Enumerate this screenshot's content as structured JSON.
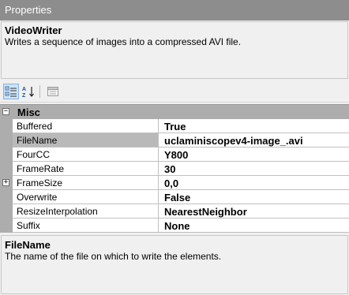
{
  "panel": {
    "title": "Properties"
  },
  "node": {
    "name": "VideoWriter",
    "description": "Writes a sequence of images into a compressed AVI file."
  },
  "toolbar": {
    "buttons": [
      {
        "icon": "categorized-icon",
        "active": true
      },
      {
        "icon": "alphabetical-sort-icon",
        "active": false
      },
      {
        "icon": "property-pages-icon",
        "active": false
      }
    ]
  },
  "grid": {
    "category": "Misc",
    "properties": [
      {
        "name": "Buffered",
        "value": "True",
        "expandable": false,
        "selected": false
      },
      {
        "name": "FileName",
        "value": "uclaminiscopev4-image_.avi",
        "expandable": false,
        "selected": true
      },
      {
        "name": "FourCC",
        "value": "Y800",
        "expandable": false,
        "selected": false
      },
      {
        "name": "FrameRate",
        "value": "30",
        "expandable": false,
        "selected": false
      },
      {
        "name": "FrameSize",
        "value": "0,0",
        "expandable": true,
        "selected": false
      },
      {
        "name": "Overwrite",
        "value": "False",
        "expandable": false,
        "selected": false
      },
      {
        "name": "ResizeInterpolation",
        "value": "NearestNeighbor",
        "expandable": false,
        "selected": false
      },
      {
        "name": "Suffix",
        "value": "None",
        "expandable": false,
        "selected": false
      }
    ]
  },
  "help": {
    "title": "FileName",
    "text": "The name of the file on which to write the elements."
  }
}
